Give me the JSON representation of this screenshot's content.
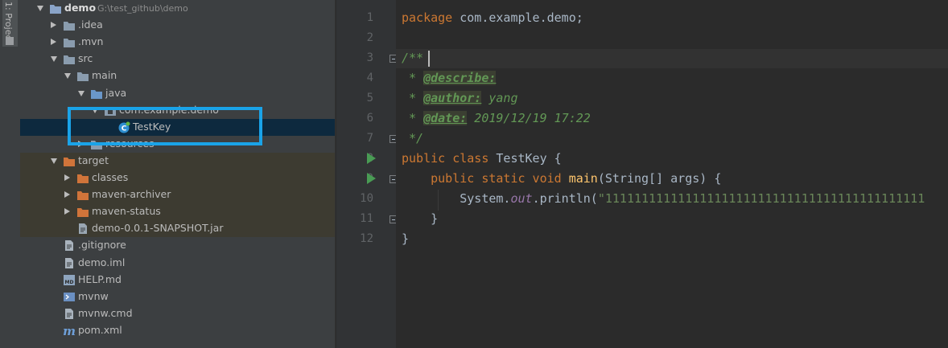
{
  "side_tab": {
    "label": "1: Project"
  },
  "tree": [
    {
      "label": "demo",
      "path": "G:\\test_github\\demo",
      "indent": 0,
      "arrow": "down",
      "icon": "module-folder-icon"
    },
    {
      "label": ".idea",
      "indent": 1,
      "arrow": "right",
      "icon": "folder-icon"
    },
    {
      "label": ".mvn",
      "indent": 1,
      "arrow": "right",
      "icon": "folder-icon"
    },
    {
      "label": "src",
      "indent": 1,
      "arrow": "down",
      "icon": "folder-icon"
    },
    {
      "label": "main",
      "indent": 2,
      "arrow": "down",
      "icon": "folder-icon"
    },
    {
      "label": "java",
      "indent": 3,
      "arrow": "down",
      "icon": "source-folder-icon"
    },
    {
      "label": "com.example.demo",
      "indent": 4,
      "arrow": "down",
      "icon": "package-icon"
    },
    {
      "label": "TestKey",
      "indent": 5,
      "arrow": "",
      "icon": "java-class-icon",
      "selected": true
    },
    {
      "label": "resources",
      "indent": 3,
      "arrow": "right",
      "icon": "resources-folder-icon"
    },
    {
      "label": "target",
      "indent": 1,
      "arrow": "down",
      "icon": "excluded-folder-icon",
      "excluded": true
    },
    {
      "label": "classes",
      "indent": 2,
      "arrow": "right",
      "icon": "excluded-folder-icon",
      "excluded": true
    },
    {
      "label": "maven-archiver",
      "indent": 2,
      "arrow": "right",
      "icon": "excluded-folder-icon",
      "excluded": true
    },
    {
      "label": "maven-status",
      "indent": 2,
      "arrow": "right",
      "icon": "excluded-folder-icon",
      "excluded": true
    },
    {
      "label": "demo-0.0.1-SNAPSHOT.jar",
      "indent": 2,
      "arrow": "",
      "icon": "jar-file-icon",
      "excluded": true
    },
    {
      "label": ".gitignore",
      "indent": 1,
      "arrow": "",
      "icon": "text-file-icon"
    },
    {
      "label": "demo.iml",
      "indent": 1,
      "arrow": "",
      "icon": "iml-file-icon"
    },
    {
      "label": "HELP.md",
      "indent": 1,
      "arrow": "",
      "icon": "markdown-file-icon"
    },
    {
      "label": "mvnw",
      "indent": 1,
      "arrow": "",
      "icon": "shell-file-icon"
    },
    {
      "label": "mvnw.cmd",
      "indent": 1,
      "arrow": "",
      "icon": "text-file-icon"
    },
    {
      "label": "pom.xml",
      "indent": 1,
      "arrow": "",
      "icon": "maven-icon"
    }
  ],
  "editor": {
    "line_numbers": [
      "1",
      "2",
      "3",
      "4",
      "5",
      "6",
      "7",
      "8",
      "9",
      "10",
      "11",
      "12"
    ],
    "current_line": 3,
    "code": {
      "l1_kw": "package",
      "l1_rest": " com.example.demo;",
      "l3": "/**",
      "l4_star": " * ",
      "l4_tag": "@describe:",
      "l5_star": " * ",
      "l5_tag": "@author:",
      "l5_val": " yang",
      "l6_star": " * ",
      "l6_tag": "@date:",
      "l6_val": " 2019/12/19 17:22",
      "l7": " */",
      "l8_kw": "public class",
      "l8_rest": " TestKey {",
      "l9_indent": "    ",
      "l9_kw": "public static void",
      "l9_sp": " ",
      "l9_fn": "main",
      "l9_rest": "(String[] args) {",
      "l10_pre": "        System.",
      "l10_field": "out",
      "l10_mid": ".println(",
      "l10_str": "\"11111111111111111111111111111111111111111111",
      "l11": "    }",
      "l12": "}"
    }
  }
}
